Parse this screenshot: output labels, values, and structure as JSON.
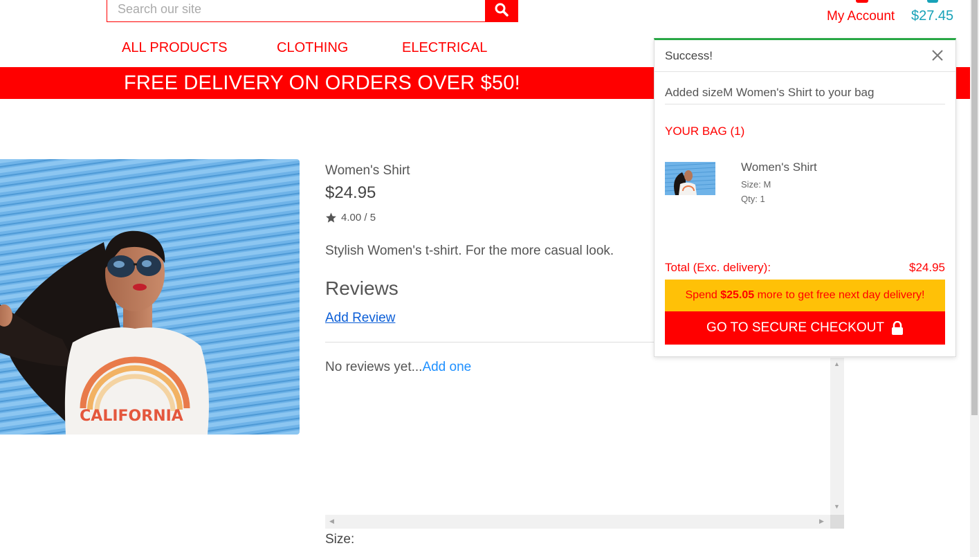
{
  "header": {
    "search_placeholder": "Search our site",
    "my_account_label": "My Account",
    "bag_total": "$27.45"
  },
  "nav": {
    "items": [
      {
        "label": "ALL PRODUCTS"
      },
      {
        "label": "CLOTHING"
      },
      {
        "label": "ELECTRICAL"
      }
    ]
  },
  "banner": {
    "text": "FREE DELIVERY ON ORDERS OVER $50!"
  },
  "product": {
    "name": "Women's Shirt",
    "price": "$24.95",
    "rating": "4.00 / 5",
    "description": "Stylish Women's t-shirt. For the more casual look.",
    "reviews_heading": "Reviews",
    "add_review_label": "Add Review",
    "no_reviews_text": "No reviews yet...",
    "add_one_label": "Add one",
    "size_label": "Size:",
    "image_text": "CALIFORNIA"
  },
  "toast": {
    "title": "Success!",
    "message": "Added sizeM Women's Shirt to your bag",
    "bag_heading": "YOUR BAG (1)",
    "item": {
      "name": "Women's Shirt",
      "size": "Size: M",
      "qty": "Qty: 1"
    },
    "total_label": "Total (Exc. delivery):",
    "total_value": "$24.95",
    "spend_prefix": "Spend ",
    "spend_amount": "$25.05",
    "spend_suffix": " more to get free next day delivery!",
    "checkout_label": "GO TO SECURE CHECKOUT"
  },
  "colors": {
    "brand_red": "#ff0000",
    "bag_teal": "#17a2b8",
    "success_green": "#28a745",
    "warning_yellow": "#ffc107",
    "link_blue": "#1e90ff"
  },
  "icons": {
    "search": "search-icon",
    "star": "star-icon",
    "close": "close-icon",
    "lock": "lock-icon",
    "account": "user-icon",
    "bag": "shopping-bag-icon"
  }
}
